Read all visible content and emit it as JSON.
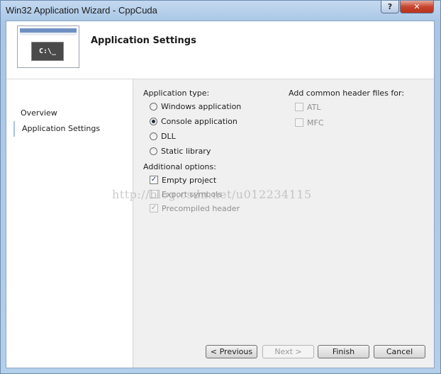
{
  "window": {
    "title": "Win32 Application Wizard - CppCuda",
    "help_glyph": "?",
    "close_glyph": "✕"
  },
  "header": {
    "title": "Application Settings",
    "image_text": "C:\\_"
  },
  "nav": {
    "items": [
      {
        "label": "Overview",
        "selected": false
      },
      {
        "label": "Application Settings",
        "selected": true
      }
    ]
  },
  "app_type": {
    "label": "Application type:",
    "options": [
      {
        "label": "Windows application",
        "checked": false
      },
      {
        "label": "Console application",
        "checked": true
      },
      {
        "label": "DLL",
        "checked": false
      },
      {
        "label": "Static library",
        "checked": false
      }
    ]
  },
  "additional": {
    "label": "Additional options:",
    "options": [
      {
        "label": "Empty project",
        "checked": true,
        "enabled": true
      },
      {
        "label": "Export symbols",
        "checked": false,
        "enabled": false
      },
      {
        "label": "Precompiled header",
        "checked": true,
        "enabled": false
      }
    ]
  },
  "headers": {
    "label": "Add common header files for:",
    "options": [
      {
        "label": "ATL",
        "checked": false,
        "enabled": false
      },
      {
        "label": "MFC",
        "checked": false,
        "enabled": false
      }
    ]
  },
  "buttons": {
    "previous": "< Previous",
    "next": "Next >",
    "finish": "Finish",
    "cancel": "Cancel"
  },
  "watermark": "http://blog.csdn.net/u012234115",
  "check_glyph": "✓"
}
